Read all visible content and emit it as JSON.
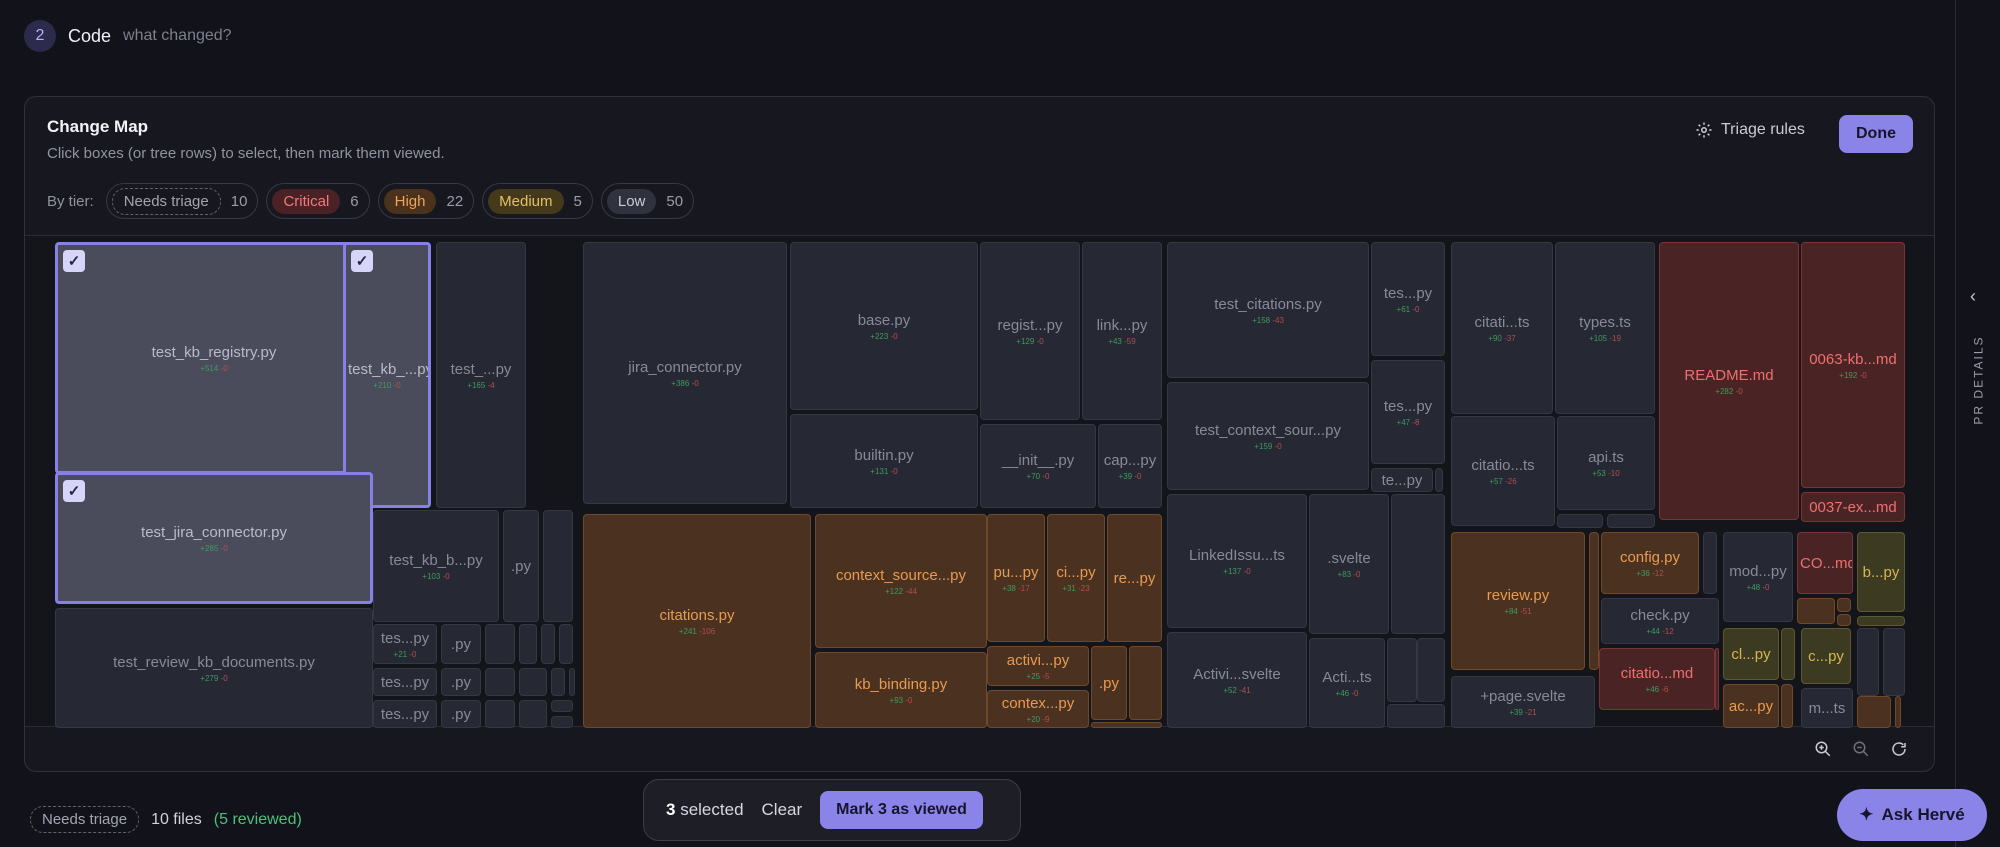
{
  "step": {
    "number": "2",
    "title": "Code",
    "subtitle": "what changed?"
  },
  "rail": {
    "label": "PR DETAILS",
    "icon": "chevron-left-icon"
  },
  "card": {
    "title": "Change Map",
    "subtitle": "Click boxes (or tree rows) to select, then mark them viewed.",
    "triage_rules_label": "Triage rules",
    "done_label": "Done"
  },
  "tiers": {
    "label": "By tier:",
    "items": [
      {
        "name": "Needs triage",
        "count": "10"
      },
      {
        "name": "Critical",
        "count": "6"
      },
      {
        "name": "High",
        "count": "22"
      },
      {
        "name": "Medium",
        "count": "5"
      },
      {
        "name": "Low",
        "count": "50"
      }
    ]
  },
  "colors": {
    "accent": "#8b84e8",
    "critical": "#ef6f6f",
    "high": "#e89a50",
    "medium": "#d4b652",
    "additions": "#3e9b5e",
    "deletions": "#b24e4e"
  },
  "treemap_files": [
    {
      "name": "test_kb_registry.py",
      "add": "+514",
      "del": "-0",
      "selected": true
    },
    {
      "name": "test_kb_...py",
      "add": "+210",
      "del": "-0",
      "selected": true
    },
    {
      "name": "test_...py",
      "add": "+165",
      "del": "-4"
    },
    {
      "name": "test_jira_connector.py",
      "add": "+285",
      "del": "-0",
      "selected": true
    },
    {
      "name": "test_kb_b...py",
      "add": "+103",
      "del": "-0"
    },
    {
      "name": ".py",
      "add": "",
      "del": ""
    },
    {
      "name": "test_review_kb_documents.py",
      "add": "+279",
      "del": "-0"
    },
    {
      "name": "tes...py",
      "add": "+21",
      "del": "-0"
    },
    {
      "name": ".py",
      "add": "",
      "del": ""
    },
    {
      "name": "tes...py",
      "add": "",
      "del": ""
    },
    {
      "name": ".py",
      "add": "",
      "del": ""
    },
    {
      "name": "tes...py",
      "add": "",
      "del": ""
    },
    {
      "name": ".py",
      "add": "",
      "del": ""
    },
    {
      "name": "jira_connector.py",
      "add": "+386",
      "del": "-0"
    },
    {
      "name": "base.py",
      "add": "+223",
      "del": "-0"
    },
    {
      "name": "regist...py",
      "add": "+129",
      "del": "-0"
    },
    {
      "name": "link...py",
      "add": "+43",
      "del": "-59"
    },
    {
      "name": "builtin.py",
      "add": "+131",
      "del": "-0"
    },
    {
      "name": "__init__.py",
      "add": "+70",
      "del": "-0"
    },
    {
      "name": "cap...py",
      "add": "+39",
      "del": "-0"
    },
    {
      "name": "citations.py",
      "add": "+241",
      "del": "-106"
    },
    {
      "name": "context_source...py",
      "add": "+122",
      "del": "-44"
    },
    {
      "name": "pu...py",
      "add": "+38",
      "del": "-17"
    },
    {
      "name": "ci...py",
      "add": "+31",
      "del": "-23"
    },
    {
      "name": "re...py",
      "add": "",
      "del": ""
    },
    {
      "name": "activi...py",
      "add": "+25",
      "del": "-5"
    },
    {
      "name": "kb_binding.py",
      "add": "+93",
      "del": "-0"
    },
    {
      "name": "contex...py",
      "add": "+20",
      "del": "-9"
    },
    {
      "name": ".py",
      "add": "",
      "del": ""
    },
    {
      "name": "test_citations.py",
      "add": "+158",
      "del": "-43"
    },
    {
      "name": "tes...py",
      "add": "+61",
      "del": "-0"
    },
    {
      "name": "tes...py",
      "add": "+47",
      "del": "-8"
    },
    {
      "name": "test_context_sour...py",
      "add": "+159",
      "del": "-0"
    },
    {
      "name": "te...py",
      "add": "",
      "del": ""
    },
    {
      "name": "LinkedIssu...ts",
      "add": "+137",
      "del": "-0"
    },
    {
      "name": ".svelte",
      "add": "+83",
      "del": "-0"
    },
    {
      "name": "Activi...svelte",
      "add": "+52",
      "del": "-41"
    },
    {
      "name": "Acti...ts",
      "add": "+46",
      "del": "-0"
    },
    {
      "name": "citati...ts",
      "add": "+90",
      "del": "-37"
    },
    {
      "name": "types.ts",
      "add": "+105",
      "del": "-19"
    },
    {
      "name": "citatio...ts",
      "add": "+57",
      "del": "-26"
    },
    {
      "name": "api.ts",
      "add": "+53",
      "del": "-10"
    },
    {
      "name": "review.py",
      "add": "+84",
      "del": "-51"
    },
    {
      "name": "+page.svelte",
      "add": "+39",
      "del": "-21"
    },
    {
      "name": "README.md",
      "add": "+282",
      "del": "-0"
    },
    {
      "name": "config.py",
      "add": "+36",
      "del": "-12"
    },
    {
      "name": "check.py",
      "add": "+44",
      "del": "-12"
    },
    {
      "name": "citatio...md",
      "add": "+46",
      "del": "-6"
    },
    {
      "name": "mod...py",
      "add": "+48",
      "del": "-0"
    },
    {
      "name": "cl...py",
      "add": "",
      "del": ""
    },
    {
      "name": "ac...py",
      "add": "",
      "del": ""
    },
    {
      "name": "0063-kb...md",
      "add": "+192",
      "del": "-0"
    },
    {
      "name": "0037-ex...md",
      "add": "",
      "del": ""
    },
    {
      "name": "CO...md",
      "add": "",
      "del": ""
    },
    {
      "name": "b...py",
      "add": "",
      "del": ""
    },
    {
      "name": "c...py",
      "add": "",
      "del": ""
    },
    {
      "name": "m...ts",
      "add": "",
      "del": ""
    }
  ],
  "footer": {
    "tier_pill": "Needs triage",
    "files": "10 files",
    "reviewed": "(5 reviewed)"
  },
  "selection": {
    "count": "3",
    "selected_label": "selected",
    "clear_label": "Clear",
    "mark_label": "Mark 3 as viewed"
  },
  "ask": {
    "label": "Ask Hervé"
  }
}
